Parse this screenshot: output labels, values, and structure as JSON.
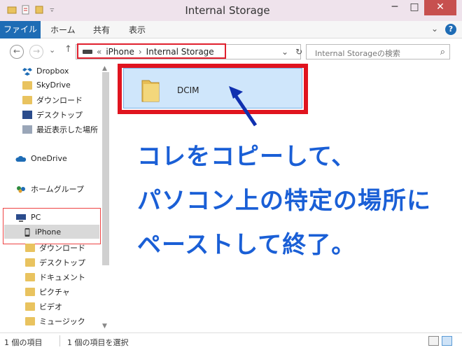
{
  "window": {
    "title": "Internal Storage",
    "minimize": "─",
    "maximize": "□",
    "close": "✕"
  },
  "ribbon": {
    "tabs": [
      "ファイル",
      "ホーム",
      "共有",
      "表示"
    ],
    "expand": "⌄",
    "help": "?"
  },
  "address": {
    "back": "←",
    "forward": "→",
    "recent": "⌄",
    "up": "↑",
    "crumb_prefix": "«",
    "crumbs": [
      "iPhone",
      "Internal Storage"
    ],
    "separator": "›",
    "dropdown": "⌄",
    "refresh": "↻",
    "search_placeholder": "Internal Storageの検索",
    "search_icon": "⌕"
  },
  "nav": {
    "items": [
      {
        "label": "Dropbox",
        "icon": "dropbox-icon"
      },
      {
        "label": "SkyDrive",
        "icon": "folder-icon"
      },
      {
        "label": "ダウンロード",
        "icon": "download-folder-icon"
      },
      {
        "label": "デスクトップ",
        "icon": "desktop-icon"
      },
      {
        "label": "最近表示した場所",
        "icon": "recent-places-icon"
      },
      {
        "label": "OneDrive",
        "icon": "onedrive-icon"
      },
      {
        "label": "ホームグループ",
        "icon": "homegroup-icon"
      },
      {
        "label": "PC",
        "icon": "pc-icon"
      },
      {
        "label": "iPhone",
        "icon": "iphone-icon"
      },
      {
        "label": "ダウンロード",
        "icon": "download-folder-icon"
      },
      {
        "label": "デスクトップ",
        "icon": "desktop-folder-icon"
      },
      {
        "label": "ドキュメント",
        "icon": "documents-folder-icon"
      },
      {
        "label": "ピクチャ",
        "icon": "pictures-folder-icon"
      },
      {
        "label": "ビデオ",
        "icon": "videos-folder-icon"
      },
      {
        "label": "ミュージック",
        "icon": "music-folder-icon"
      }
    ],
    "scroll_up": "▲",
    "scroll_down": "▼"
  },
  "content": {
    "folder_name": "DCIM",
    "callout_lines": [
      "コレをコピーして、",
      "パソコン上の特定の場所に",
      "ペーストして終了。"
    ]
  },
  "status": {
    "item_count": "1 個の項目",
    "selected": "1 個の項目を選択"
  },
  "colors": {
    "accent": "#1e6cb5",
    "callout": "#1a5fd6",
    "highlight": "#e0141f"
  }
}
